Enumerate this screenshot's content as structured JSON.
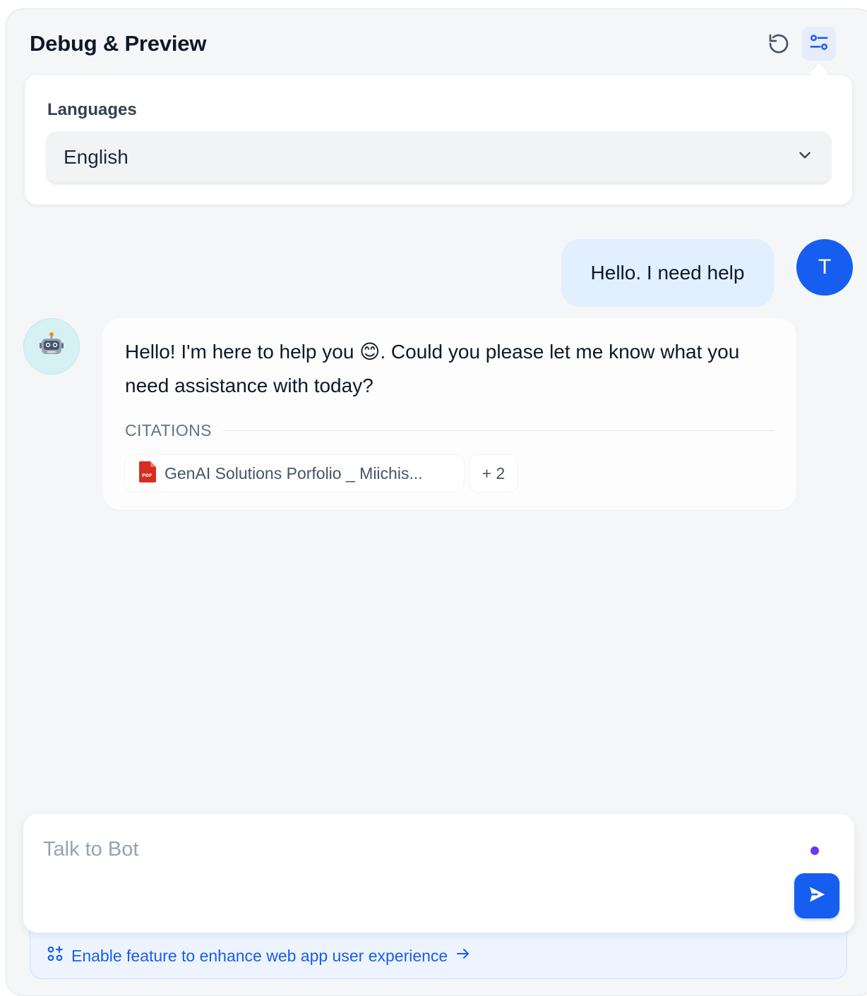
{
  "header": {
    "title": "Debug & Preview",
    "reset_icon": "rotate-ccw-icon",
    "settings_icon": "settings-sliders-icon"
  },
  "languages": {
    "label": "Languages",
    "selected": "English",
    "dropdown_icon": "chevron-down-icon"
  },
  "messages": {
    "user": {
      "text": "Hello. I need help",
      "avatar_initial": "T"
    },
    "bot": {
      "avatar_icon": "robot-emoji-icon",
      "text": "Hello! I'm here to help you 😊. Could you please let me know what you need assistance with today?",
      "citations_label": "CITATIONS",
      "citations": [
        {
          "name": "GenAI Solutions Porfolio _ Miichis...",
          "icon": "pdf-file-icon"
        }
      ],
      "more_citations": "+ 2"
    }
  },
  "composer": {
    "placeholder": "Talk to Bot",
    "send_icon": "send-icon"
  },
  "footer": {
    "link_text": "Enable feature to enhance web app user experience",
    "feature_icon": "feature-grid-icon",
    "arrow_icon": "arrow-right-icon"
  },
  "colors": {
    "accent": "#155eef",
    "user_bubble": "#e1effe",
    "panel_bg": "#f5f6f8",
    "voice_dot": "#6938ef"
  }
}
